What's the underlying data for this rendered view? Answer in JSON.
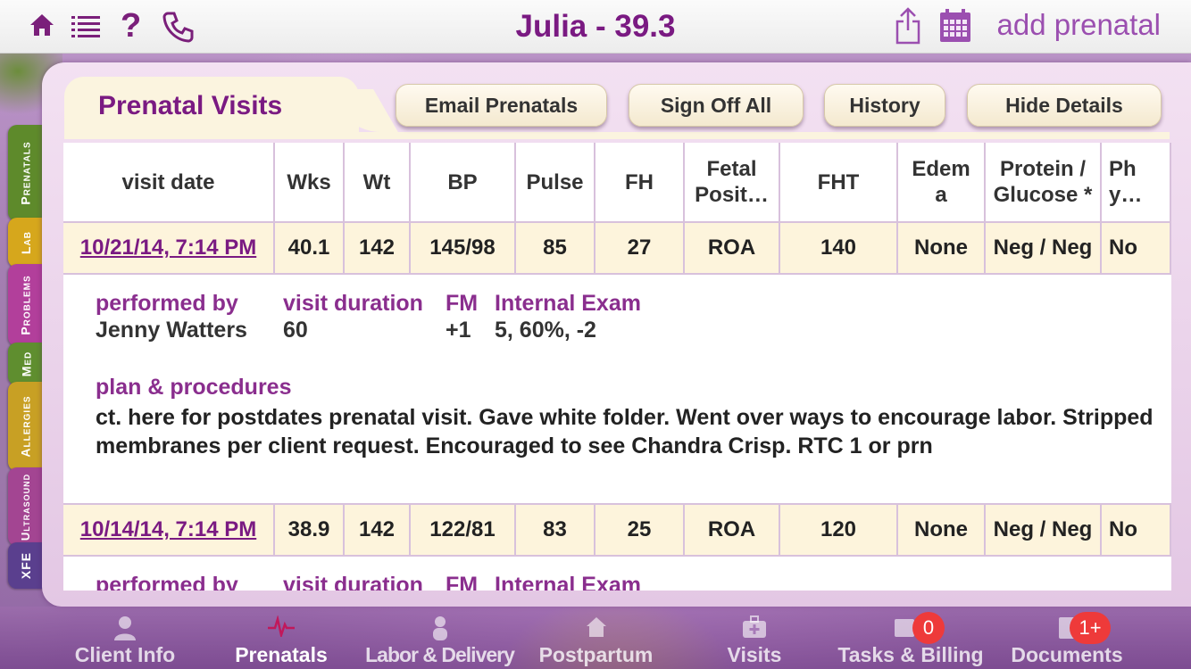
{
  "header": {
    "title": "Julia - 39.3",
    "add_label": "add prenatal"
  },
  "section": {
    "title": "Prenatal Visits",
    "buttons": [
      "Email Prenatals",
      "Sign Off All",
      "History",
      "Hide Details"
    ]
  },
  "side_tabs": [
    "Prenatals",
    "Lab",
    "Problems",
    "Med",
    "Allergies",
    "Ultrasound",
    "XFE"
  ],
  "table": {
    "columns": [
      "visit date",
      "Wks",
      "Wt",
      "BP",
      "Pulse",
      "FH",
      "Fetal\nPosit…",
      "FHT",
      "Edem\na",
      "Protein /\nGlucose *",
      "Ph\ny…"
    ],
    "rows": [
      [
        "10/21/14, 7:14 PM",
        "40.1",
        "142",
        "145/98",
        "85",
        "27",
        "ROA",
        "140",
        "None",
        "Neg / Neg",
        "No"
      ],
      [
        "10/14/14, 7:14 PM",
        "38.9",
        "142",
        "122/81",
        "83",
        "25",
        "ROA",
        "120",
        "None",
        "Neg / Neg",
        "No"
      ]
    ],
    "details": [
      {
        "performed_by_label": "performed by",
        "performed_by": "Jenny Watters",
        "duration_label": "visit duration",
        "duration": "60",
        "fm_label": "FM",
        "fm": "+1",
        "exam_label": "Internal Exam",
        "exam": "5, 60%, -2",
        "plan_label": "plan & procedures",
        "plan": "ct. here for postdates prenatal visit.  Gave white folder.  Went over ways to encourage labor.  Stripped membranes per client request. Encouraged to see Chandra Crisp. RTC 1 or prn"
      },
      {
        "performed_by_label": "performed by",
        "duration_label": "visit duration",
        "fm_label": "FM",
        "exam_label": "Internal Exam"
      }
    ]
  },
  "tabbar": {
    "items": [
      "Client Info",
      "Prenatals",
      "Labor & Delivery",
      "Postpartum",
      "Visits",
      "Tasks & Billing",
      "Documents"
    ],
    "badges": {
      "tasks": "0",
      "documents": "1+"
    }
  },
  "colors": {
    "brand": "#7a1a82",
    "accent": "#9b4fb0",
    "row_bg": "#fdf4dc",
    "badge": "#ee3a3a"
  }
}
